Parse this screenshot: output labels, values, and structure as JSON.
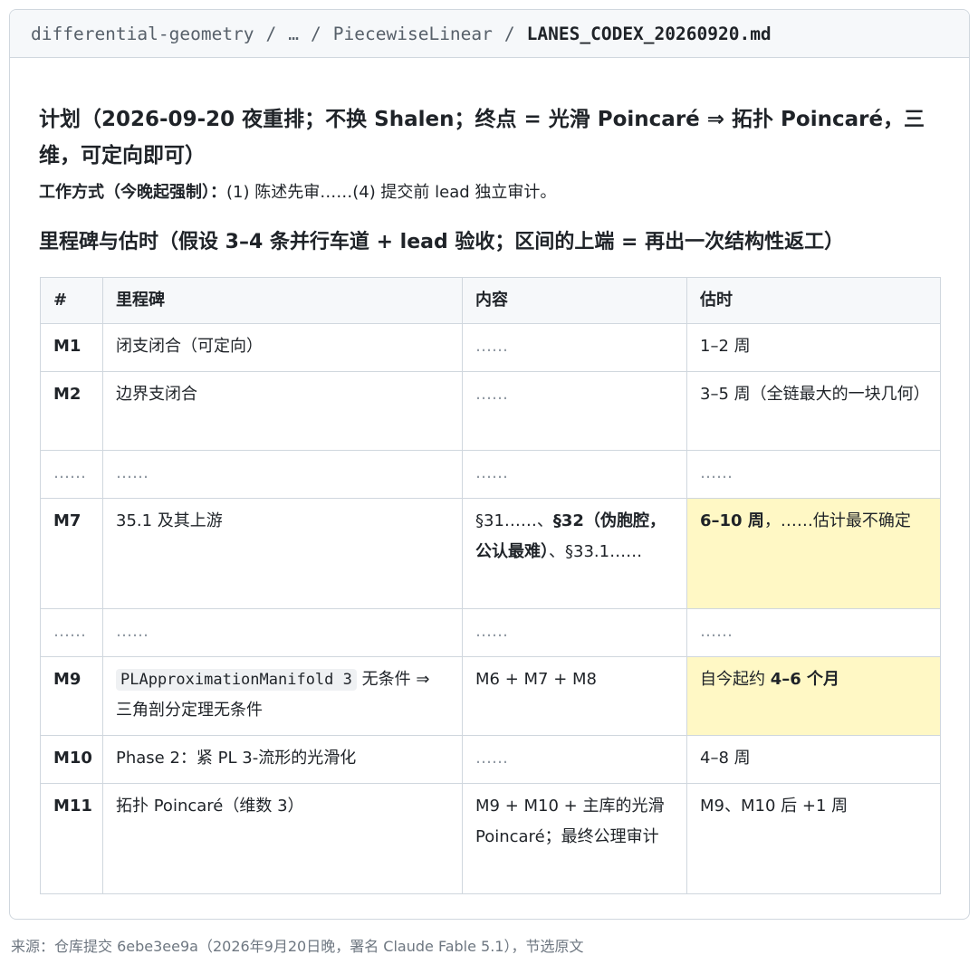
{
  "breadcrumb": {
    "root": "differential-geometry",
    "sep": "/",
    "ellipsis": "…",
    "folder": "PiecewiseLinear",
    "file": "LANES_CODEX_20260920.md"
  },
  "plan": {
    "title": "计划（2026-09-20 夜重排；不换 Shalen；终点 = 光滑 Poincaré ⇒ 拓扑 Poincaré，三维，可定向即可）",
    "work_label": "工作方式（今晚起强制）：",
    "work_text": "(1) 陈述先审……(4) 提交前 lead 独立审计。"
  },
  "milestones_title": "里程碑与估时（假设 3–4 条并行车道 + lead 验收；区间的上端 = 再出一次结构性返工）",
  "table": {
    "headers": [
      "#",
      "里程碑",
      "内容",
      "估时"
    ],
    "ellipsis": "……",
    "m1": {
      "id": "M1",
      "milestone": "闭支闭合（可定向）",
      "content": "……",
      "estimate": "1–2 周"
    },
    "m2": {
      "id": "M2",
      "milestone": "边界支闭合",
      "content": "……",
      "estimate": "3–5 周（全链最大的一块几何）"
    },
    "m7": {
      "id": "M7",
      "milestone": "35.1 及其上游",
      "content_a": "§31……、",
      "content_b": "§32（伪胞腔，公认最难）",
      "content_c": "、§33.1……",
      "estimate_bold": "6–10 周",
      "estimate_rest": "，……估计最不确定"
    },
    "m9": {
      "id": "M9",
      "milestone_code": "PLApproximationManifold 3",
      "milestone_rest": " 无条件 ⇒ 三角剖分定理无条件",
      "content": "M6 + M7 + M8",
      "estimate_pre": "自今起约 ",
      "estimate_bold": "4–6 个月"
    },
    "m10": {
      "id": "M10",
      "milestone": "Phase 2：紧 PL 3-流形的光滑化",
      "content": "……",
      "estimate": "4–8 周"
    },
    "m11": {
      "id": "M11",
      "milestone": "拓扑 Poincaré（维数 3）",
      "content": "M9 + M10 + 主库的光滑 Poincaré；最终公理审计",
      "estimate": "M9、M10 后 +1 周"
    }
  },
  "source_note": "来源：仓库提交 6ebe3ee9a（2026年9月20日晚，署名 Claude Fable 5.1），节选原文",
  "colors": {
    "highlight": "#fff8c5",
    "border": "#d0d7de",
    "header_bg": "#f6f8fa"
  }
}
